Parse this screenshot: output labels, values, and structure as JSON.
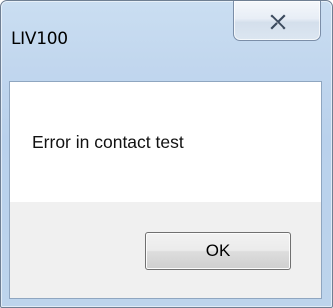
{
  "window": {
    "title": "LIV100"
  },
  "message": {
    "text": "Error in contact test"
  },
  "buttons": {
    "ok_label": "OK"
  },
  "icons": {
    "close": "close-x-icon"
  },
  "colors": {
    "titlebar": "#c2d7ee",
    "message_background": "#ffffff",
    "button_area_background": "#f0f0f0"
  }
}
